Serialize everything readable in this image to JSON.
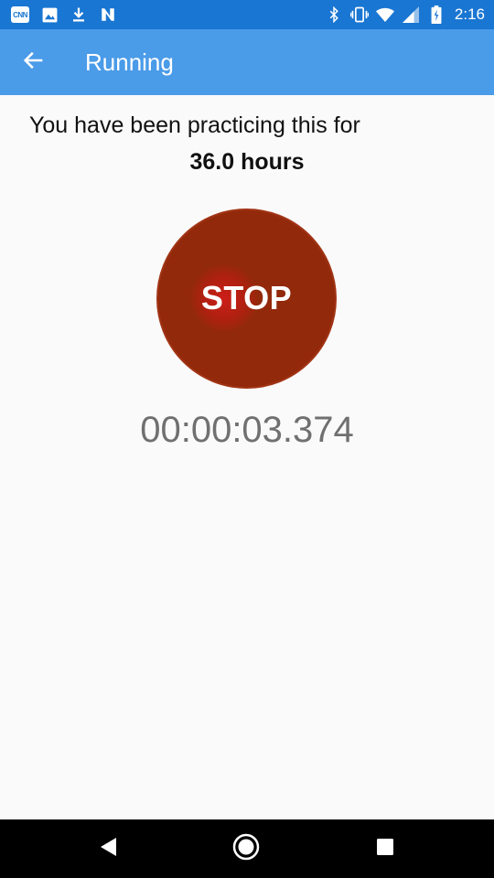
{
  "status_bar": {
    "notification_icons": [
      "cnn-icon",
      "image-icon",
      "download-icon",
      "n-icon"
    ],
    "cnn_label": "CNN",
    "system_icons": [
      "bluetooth-icon",
      "vibrate-icon",
      "wifi-icon",
      "signal-icon",
      "battery-icon"
    ],
    "time": "2:16"
  },
  "app_bar": {
    "back_icon": "arrow-left-icon",
    "title": "Running"
  },
  "main": {
    "practice_text": "You have been practicing this for",
    "hours_text": "36.0 hours",
    "stop_button_label": "STOP",
    "timer": "00:00:03.374"
  },
  "nav_bar": {
    "icons": [
      "back-triangle-icon",
      "home-circle-icon",
      "recents-square-icon"
    ]
  },
  "colors": {
    "status_bar": "#1976d2",
    "app_bar": "#4a9be8",
    "stop_button": "#93290b",
    "background": "#fafafa",
    "timer_text": "#707070"
  }
}
